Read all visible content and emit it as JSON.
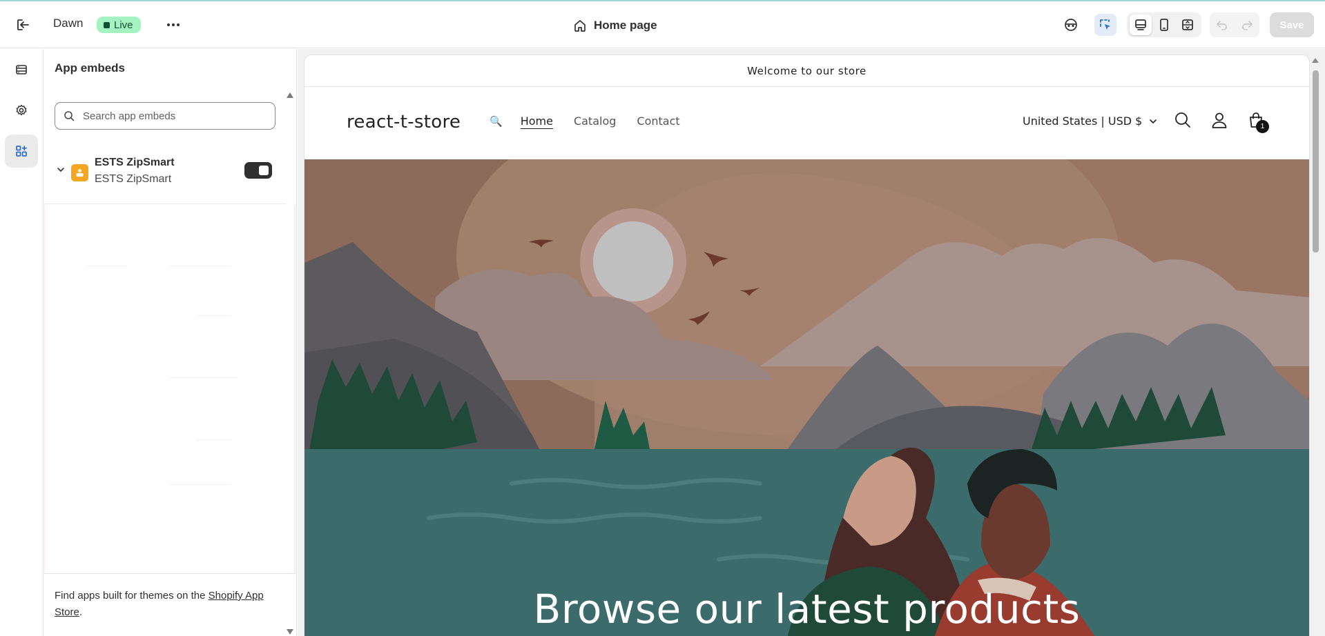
{
  "topbar": {
    "theme_name": "Dawn",
    "live_badge": "Live",
    "page_title": "Home page",
    "save_label": "Save"
  },
  "panel": {
    "title": "App embeds",
    "search_placeholder": "Search app embeds",
    "embed": {
      "name": "ESTS ZipSmart",
      "subtitle": "ESTS ZipSmart",
      "enabled": true
    },
    "footer_text": "Find apps built for themes on the ",
    "footer_link": "Shopify App Store",
    "footer_suffix": "."
  },
  "preview": {
    "announcement": "Welcome to our store",
    "store_name": "react-t-store",
    "nav_emoji": "🔍",
    "nav": [
      "Home",
      "Catalog",
      "Contact"
    ],
    "country": "United States | USD $",
    "cart_count": "1",
    "hero_heading": "Browse our latest products"
  },
  "colors": {
    "live_bg": "#a6f3c2",
    "selected_tool": "#e3ebf8",
    "hero_sky": "#8d6b5b",
    "hero_water": "#3b6b6b"
  }
}
